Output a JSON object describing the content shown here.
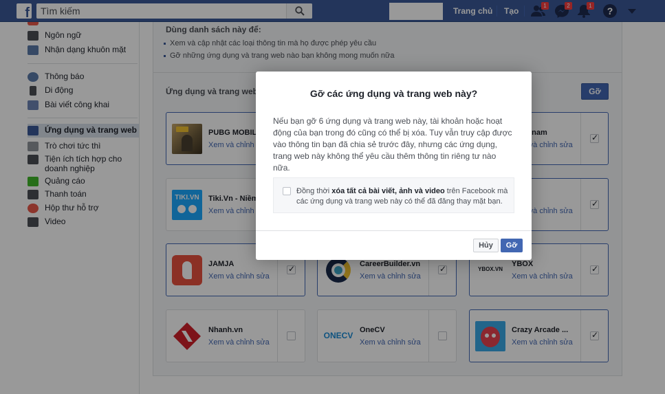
{
  "topbar": {
    "logo_letter": "f",
    "search_placeholder": "Tìm kiếm",
    "nav_home": "Trang chủ",
    "nav_create": "Tạo",
    "friend_requests_count": "1",
    "messages_count": "2",
    "notifications_count": "1",
    "help_glyph": "?"
  },
  "sidebar": {
    "items": [
      {
        "label": "Ngôn ngữ",
        "icon": "language-icon"
      },
      {
        "label": "Nhận dạng khuôn mặt",
        "icon": "face-recognition-icon"
      },
      {
        "label": "Thông báo",
        "icon": "globe-icon"
      },
      {
        "label": "Di động",
        "icon": "mobile-icon"
      },
      {
        "label": "Bài viết công khai",
        "icon": "public-posts-icon"
      },
      {
        "label": "Ứng dụng và trang web",
        "icon": "apps-icon",
        "active": true
      },
      {
        "label": "Trò chơi tức thì",
        "icon": "gamepad-icon"
      },
      {
        "label": "Tiện ích tích hợp cho doanh nghiệp",
        "icon": "business-integrations-icon"
      },
      {
        "label": "Quảng cáo",
        "icon": "ads-icon"
      },
      {
        "label": "Thanh toán",
        "icon": "payments-icon"
      },
      {
        "label": "Hộp thư hỗ trợ",
        "icon": "support-inbox-icon"
      },
      {
        "label": "Video",
        "icon": "video-icon"
      }
    ]
  },
  "main": {
    "info_heading": "Dùng danh sách này để:",
    "info_bullets": [
      "Xem và cập nhật các loại thông tin mà họ được phép yêu cầu",
      "Gỡ những ứng dụng và trang web nào bạn không mong muốn nữa"
    ],
    "section_title": "Ứng dụng và trang web đa",
    "remove_button": "Gỡ",
    "edit_link": "Xem và chỉnh sửa",
    "apps": [
      {
        "name": "PUBG MOBILE",
        "checked": true
      },
      {
        "name": "a Vietnam",
        "checked": true
      },
      {
        "name": "Tiki.Vn - Niềm",
        "checked": false
      },
      {
        "name": "",
        "checked": true
      },
      {
        "name": "JAMJA",
        "checked": true
      },
      {
        "name": "CareerBuilder.vn",
        "checked": true
      },
      {
        "name": "YBOX",
        "checked": true
      },
      {
        "name": "Nhanh.vn",
        "checked": false
      },
      {
        "name": "OneCV",
        "checked": false
      },
      {
        "name": "Crazy Arcade ...",
        "checked": true
      }
    ],
    "logos": {
      "tiki": "TIKI.VN",
      "onecv": "ONECV",
      "ybox": "YBOX.VN"
    }
  },
  "dialog": {
    "title": "Gỡ các ứng dụng và trang web này?",
    "body": "Nếu bạn gỡ 6 ứng dụng và trang web này, tài khoản hoặc hoạt động của bạn trong đó cũng có thể bị xóa. Tuy vẫn truy cập được vào thông tin bạn đã chia sẻ trước đây, nhưng các ứng dụng, trang web này không thể yêu cầu thêm thông tin riêng tư nào nữa.",
    "checkbox_prefix": "Đồng thời ",
    "checkbox_bold": "xóa tất cả bài viết, ảnh và video",
    "checkbox_suffix": " trên Facebook mà các ứng dụng và trang web này có thể đã đăng thay mặt bạn.",
    "cancel": "Hủy",
    "confirm": "Gỡ"
  }
}
